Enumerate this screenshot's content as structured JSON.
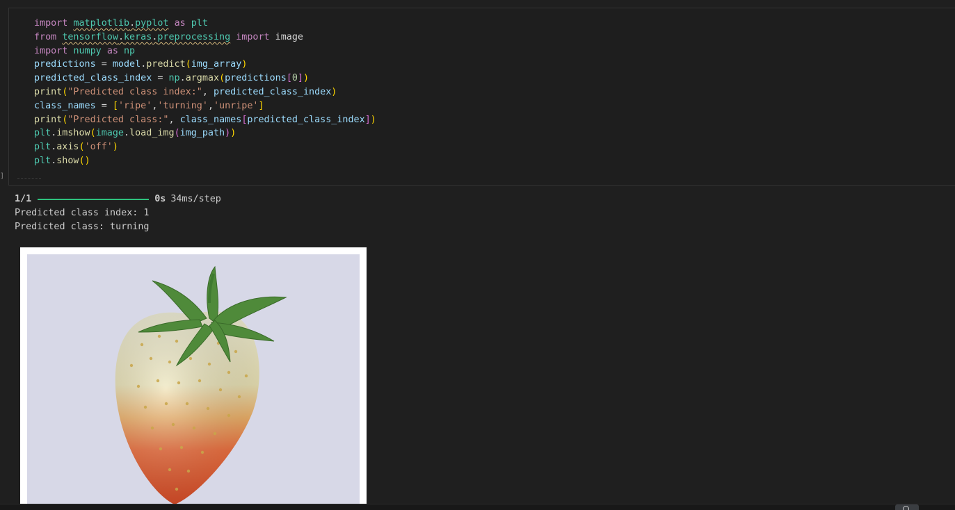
{
  "cell": {
    "code": [
      [
        {
          "t": "import",
          "c": "kw"
        },
        {
          "t": " "
        },
        {
          "t": "matplotlib",
          "c": "mod squig"
        },
        {
          "t": ".",
          "c": "squig"
        },
        {
          "t": "pyplot",
          "c": "mod squig"
        },
        {
          "t": " "
        },
        {
          "t": "as",
          "c": "kw"
        },
        {
          "t": " "
        },
        {
          "t": "plt",
          "c": "mod"
        }
      ],
      [
        {
          "t": "from",
          "c": "kw"
        },
        {
          "t": " "
        },
        {
          "t": "tensorflow",
          "c": "mod squig"
        },
        {
          "t": ".",
          "c": "squig"
        },
        {
          "t": "keras",
          "c": "mod squig"
        },
        {
          "t": ".",
          "c": "squig"
        },
        {
          "t": "preprocessing",
          "c": "mod squig"
        },
        {
          "t": " "
        },
        {
          "t": "import",
          "c": "kw"
        },
        {
          "t": " image"
        }
      ],
      [
        {
          "t": "import",
          "c": "kw"
        },
        {
          "t": " "
        },
        {
          "t": "numpy",
          "c": "mod"
        },
        {
          "t": " "
        },
        {
          "t": "as",
          "c": "kw"
        },
        {
          "t": " "
        },
        {
          "t": "np",
          "c": "mod"
        }
      ],
      [
        {
          "t": "predictions",
          "c": "var"
        },
        {
          "t": " = "
        },
        {
          "t": "model",
          "c": "var"
        },
        {
          "t": "."
        },
        {
          "t": "predict",
          "c": "fn"
        },
        {
          "t": "(",
          "c": "br1"
        },
        {
          "t": "img_array",
          "c": "var"
        },
        {
          "t": ")",
          "c": "br1"
        }
      ],
      [
        {
          "t": "predicted_class_index",
          "c": "var"
        },
        {
          "t": " = "
        },
        {
          "t": "np",
          "c": "mod"
        },
        {
          "t": "."
        },
        {
          "t": "argmax",
          "c": "fn"
        },
        {
          "t": "(",
          "c": "br1"
        },
        {
          "t": "predictions",
          "c": "var"
        },
        {
          "t": "[",
          "c": "br2"
        },
        {
          "t": "0",
          "c": "num"
        },
        {
          "t": "]",
          "c": "br2"
        },
        {
          "t": ")",
          "c": "br1"
        }
      ],
      [
        {
          "t": "print",
          "c": "fn"
        },
        {
          "t": "(",
          "c": "br1"
        },
        {
          "t": "\"Predicted class index:\"",
          "c": "str"
        },
        {
          "t": ", "
        },
        {
          "t": "predicted_class_index",
          "c": "var"
        },
        {
          "t": ")",
          "c": "br1"
        }
      ],
      [
        {
          "t": "class_names",
          "c": "var"
        },
        {
          "t": " = "
        },
        {
          "t": "[",
          "c": "br1"
        },
        {
          "t": "'ripe'",
          "c": "str"
        },
        {
          "t": ","
        },
        {
          "t": "'turning'",
          "c": "str"
        },
        {
          "t": ","
        },
        {
          "t": "'unripe'",
          "c": "str"
        },
        {
          "t": "]",
          "c": "br1"
        }
      ],
      [
        {
          "t": "print",
          "c": "fn"
        },
        {
          "t": "(",
          "c": "br1"
        },
        {
          "t": "\"Predicted class:\"",
          "c": "str"
        },
        {
          "t": ", "
        },
        {
          "t": "class_names",
          "c": "var"
        },
        {
          "t": "[",
          "c": "br2"
        },
        {
          "t": "predicted_class_index",
          "c": "var"
        },
        {
          "t": "]",
          "c": "br2"
        },
        {
          "t": ")",
          "c": "br1"
        }
      ],
      [
        {
          "t": "plt",
          "c": "mod"
        },
        {
          "t": "."
        },
        {
          "t": "imshow",
          "c": "fn"
        },
        {
          "t": "(",
          "c": "br1"
        },
        {
          "t": "image",
          "c": "mod"
        },
        {
          "t": "."
        },
        {
          "t": "load_img",
          "c": "fn"
        },
        {
          "t": "(",
          "c": "br2"
        },
        {
          "t": "img_path",
          "c": "var"
        },
        {
          "t": ")",
          "c": "br2"
        },
        {
          "t": ")",
          "c": "br1"
        }
      ],
      [
        {
          "t": "plt",
          "c": "mod"
        },
        {
          "t": "."
        },
        {
          "t": "axis",
          "c": "fn"
        },
        {
          "t": "(",
          "c": "br1"
        },
        {
          "t": "'off'",
          "c": "str"
        },
        {
          "t": ")",
          "c": "br1"
        }
      ],
      [
        {
          "t": "plt",
          "c": "mod"
        },
        {
          "t": "."
        },
        {
          "t": "show",
          "c": "fn"
        },
        {
          "t": "(",
          "c": "br1"
        },
        {
          "t": ")",
          "c": "br1"
        }
      ]
    ]
  },
  "output": {
    "progress": {
      "step": "1/1",
      "time": "0s",
      "rate": "34ms/step",
      "fraction": 1.0
    },
    "lines": [
      "Predicted class index: 1",
      "Predicted class: turning"
    ]
  },
  "colors": {
    "background": "#1f1f1f",
    "progress_bar": "#2ec27e",
    "keyword": "#c586c0",
    "string": "#ce9178",
    "variable": "#9cdcfe",
    "function": "#dcdcaa"
  }
}
